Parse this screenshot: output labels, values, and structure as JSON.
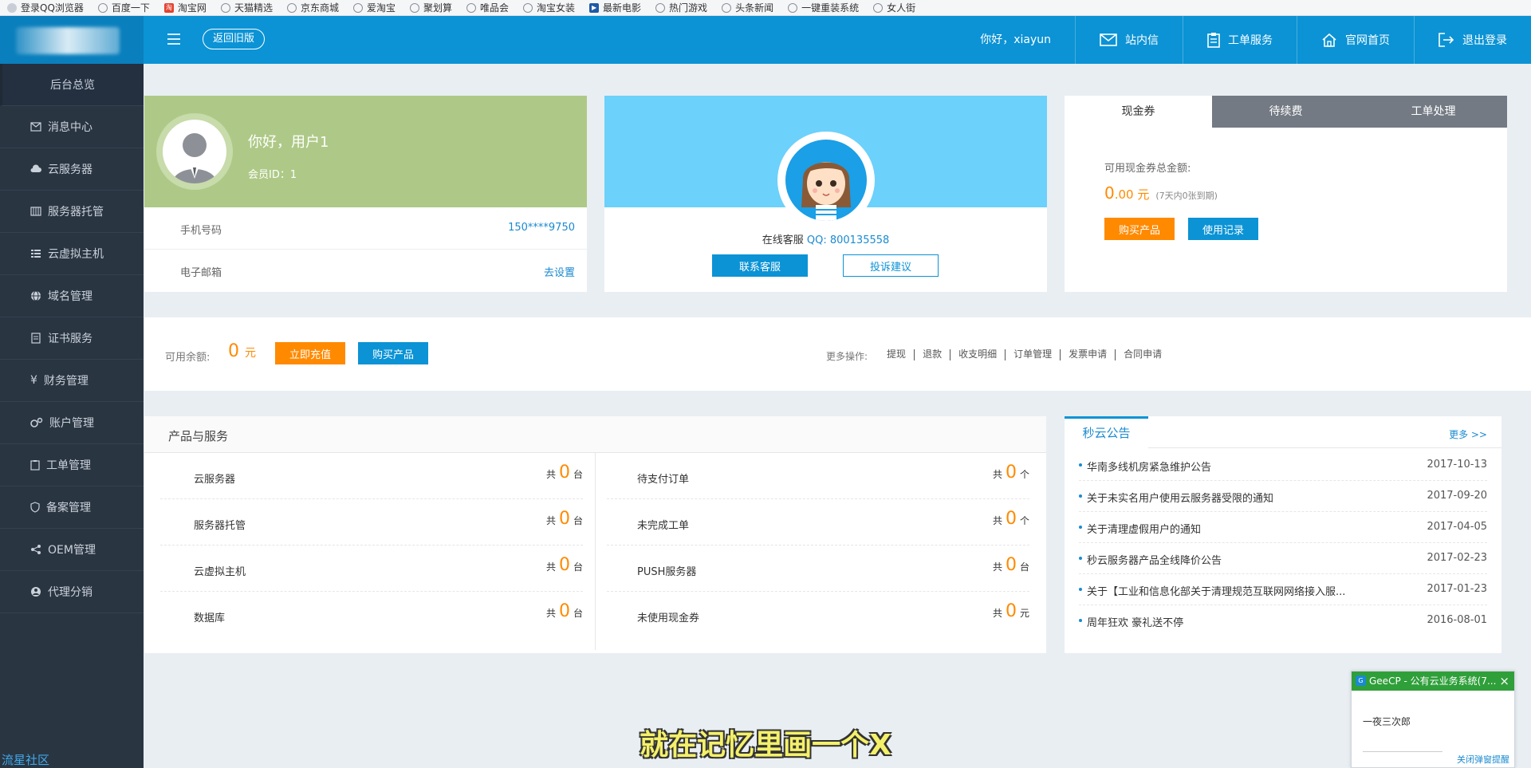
{
  "bookmarks": [
    "登录QQ浏览器",
    "百度一下",
    "淘宝网",
    "天猫精选",
    "京东商城",
    "爱淘宝",
    "聚划算",
    "唯品会",
    "淘宝女装",
    "最新电影",
    "热门游戏",
    "头条新闻",
    "一键重装系统",
    "女人街"
  ],
  "header": {
    "back_label": "返回旧版",
    "greeting": "你好，xiayun",
    "nav": [
      "站内信",
      "工单服务",
      "官网首页",
      "退出登录"
    ]
  },
  "sidebar": {
    "items": [
      "后台总览",
      "消息中心",
      "云服务器",
      "服务器托管",
      "云虚拟主机",
      "域名管理",
      "证书服务",
      "财务管理",
      "账户管理",
      "工单管理",
      "备案管理",
      "OEM管理",
      "代理分销"
    ],
    "footer": "流星社区"
  },
  "user_card": {
    "hello": "你好，用户1",
    "member_id": "会员ID：1",
    "phone_label": "手机号码",
    "phone_value": "150****9750",
    "email_label": "电子邮箱",
    "email_action": "去设置"
  },
  "service_card": {
    "qq_prefix": "在线客服",
    "qq_value": "QQ: 800135558",
    "contact_button": "联系客服",
    "complaint_button": "投诉建议"
  },
  "coupon_card": {
    "tabs": [
      "现金券",
      "待续费",
      "工单处理"
    ],
    "active_tab": 0,
    "label": "可用现金券总金额:",
    "amount": "0",
    "amount_decimal": ".00 元",
    "note": "(7天内0张到期)",
    "buy_button": "购买产品",
    "record_button": "使用记录"
  },
  "balance": {
    "label": "可用余额:",
    "amount": "0",
    "unit": "元",
    "recharge_button": "立即充值",
    "buy_button": "购买产品",
    "more_label": "更多操作:",
    "ops": [
      "提现",
      "退款",
      "收支明细",
      "订单管理",
      "发票申请",
      "合同申请"
    ]
  },
  "products": {
    "title": "产品与服务",
    "total_prefix": "共",
    "left": [
      {
        "name": "云服务器",
        "count": "0",
        "unit": "台"
      },
      {
        "name": "服务器托管",
        "count": "0",
        "unit": "台"
      },
      {
        "name": "云虚拟主机",
        "count": "0",
        "unit": "台"
      },
      {
        "name": "数据库",
        "count": "0",
        "unit": "台"
      }
    ],
    "right": [
      {
        "name": "待支付订单",
        "count": "0",
        "unit": "个"
      },
      {
        "name": "未完成工单",
        "count": "0",
        "unit": "个"
      },
      {
        "name": "PUSH服务器",
        "count": "0",
        "unit": "台"
      },
      {
        "name": "未使用现金券",
        "count": "0",
        "unit": "元"
      }
    ]
  },
  "notices": {
    "title": "秒云公告",
    "more": "更多 >>",
    "items": [
      {
        "title": "华南多线机房紧急维护公告",
        "date": "2017-10-13"
      },
      {
        "title": "关于未实名用户使用云服务器受限的通知",
        "date": "2017-09-20"
      },
      {
        "title": "关于清理虚假用户的通知",
        "date": "2017-04-05"
      },
      {
        "title": "秒云服务器产品全线降价公告",
        "date": "2017-02-23"
      },
      {
        "title": "关于【工业和信息化部关于清理规范互联网网络接入服...",
        "date": "2017-01-23"
      },
      {
        "title": "周年狂欢 豪礼送不停",
        "date": "2016-08-01"
      }
    ]
  },
  "popup": {
    "title": "GeeCP - 公有云业务系统(7...",
    "body": "一夜三次郎",
    "close_link": "关闭弹窗提醒"
  },
  "subtitle": "就在记忆里画一个X",
  "colors": {
    "primary": "#0b93d5",
    "orange": "#ff8a00",
    "sidebar": "#2a3542",
    "user_card": "#aec987",
    "service_card": "#6cd1fb"
  }
}
